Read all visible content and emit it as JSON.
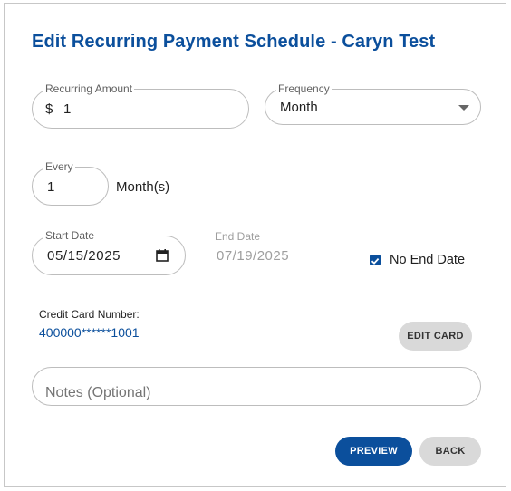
{
  "dialog": {
    "title": "Edit Recurring Payment Schedule - Caryn Test"
  },
  "recurring_amount": {
    "label": "Recurring Amount",
    "currency_symbol": "$",
    "value": "1"
  },
  "frequency": {
    "label": "Frequency",
    "value": "Month"
  },
  "every": {
    "label": "Every",
    "value": "1",
    "unit": "Month(s)"
  },
  "start_date": {
    "label": "Start Date",
    "value": "05/15/2025"
  },
  "end_date": {
    "label": "End Date",
    "value": "07/19/2025"
  },
  "no_end_date": {
    "label": "No End Date",
    "checked": true
  },
  "credit_card": {
    "label": "Credit Card Number:",
    "number": "400000******1001",
    "edit_label": "EDIT CARD"
  },
  "notes": {
    "placeholder": "Notes (Optional)"
  },
  "actions": {
    "preview_label": "PREVIEW",
    "back_label": "BACK"
  },
  "colors": {
    "accent": "#0b4f9c",
    "button_grey": "#d9d9d9",
    "border": "#bdbdbd"
  }
}
